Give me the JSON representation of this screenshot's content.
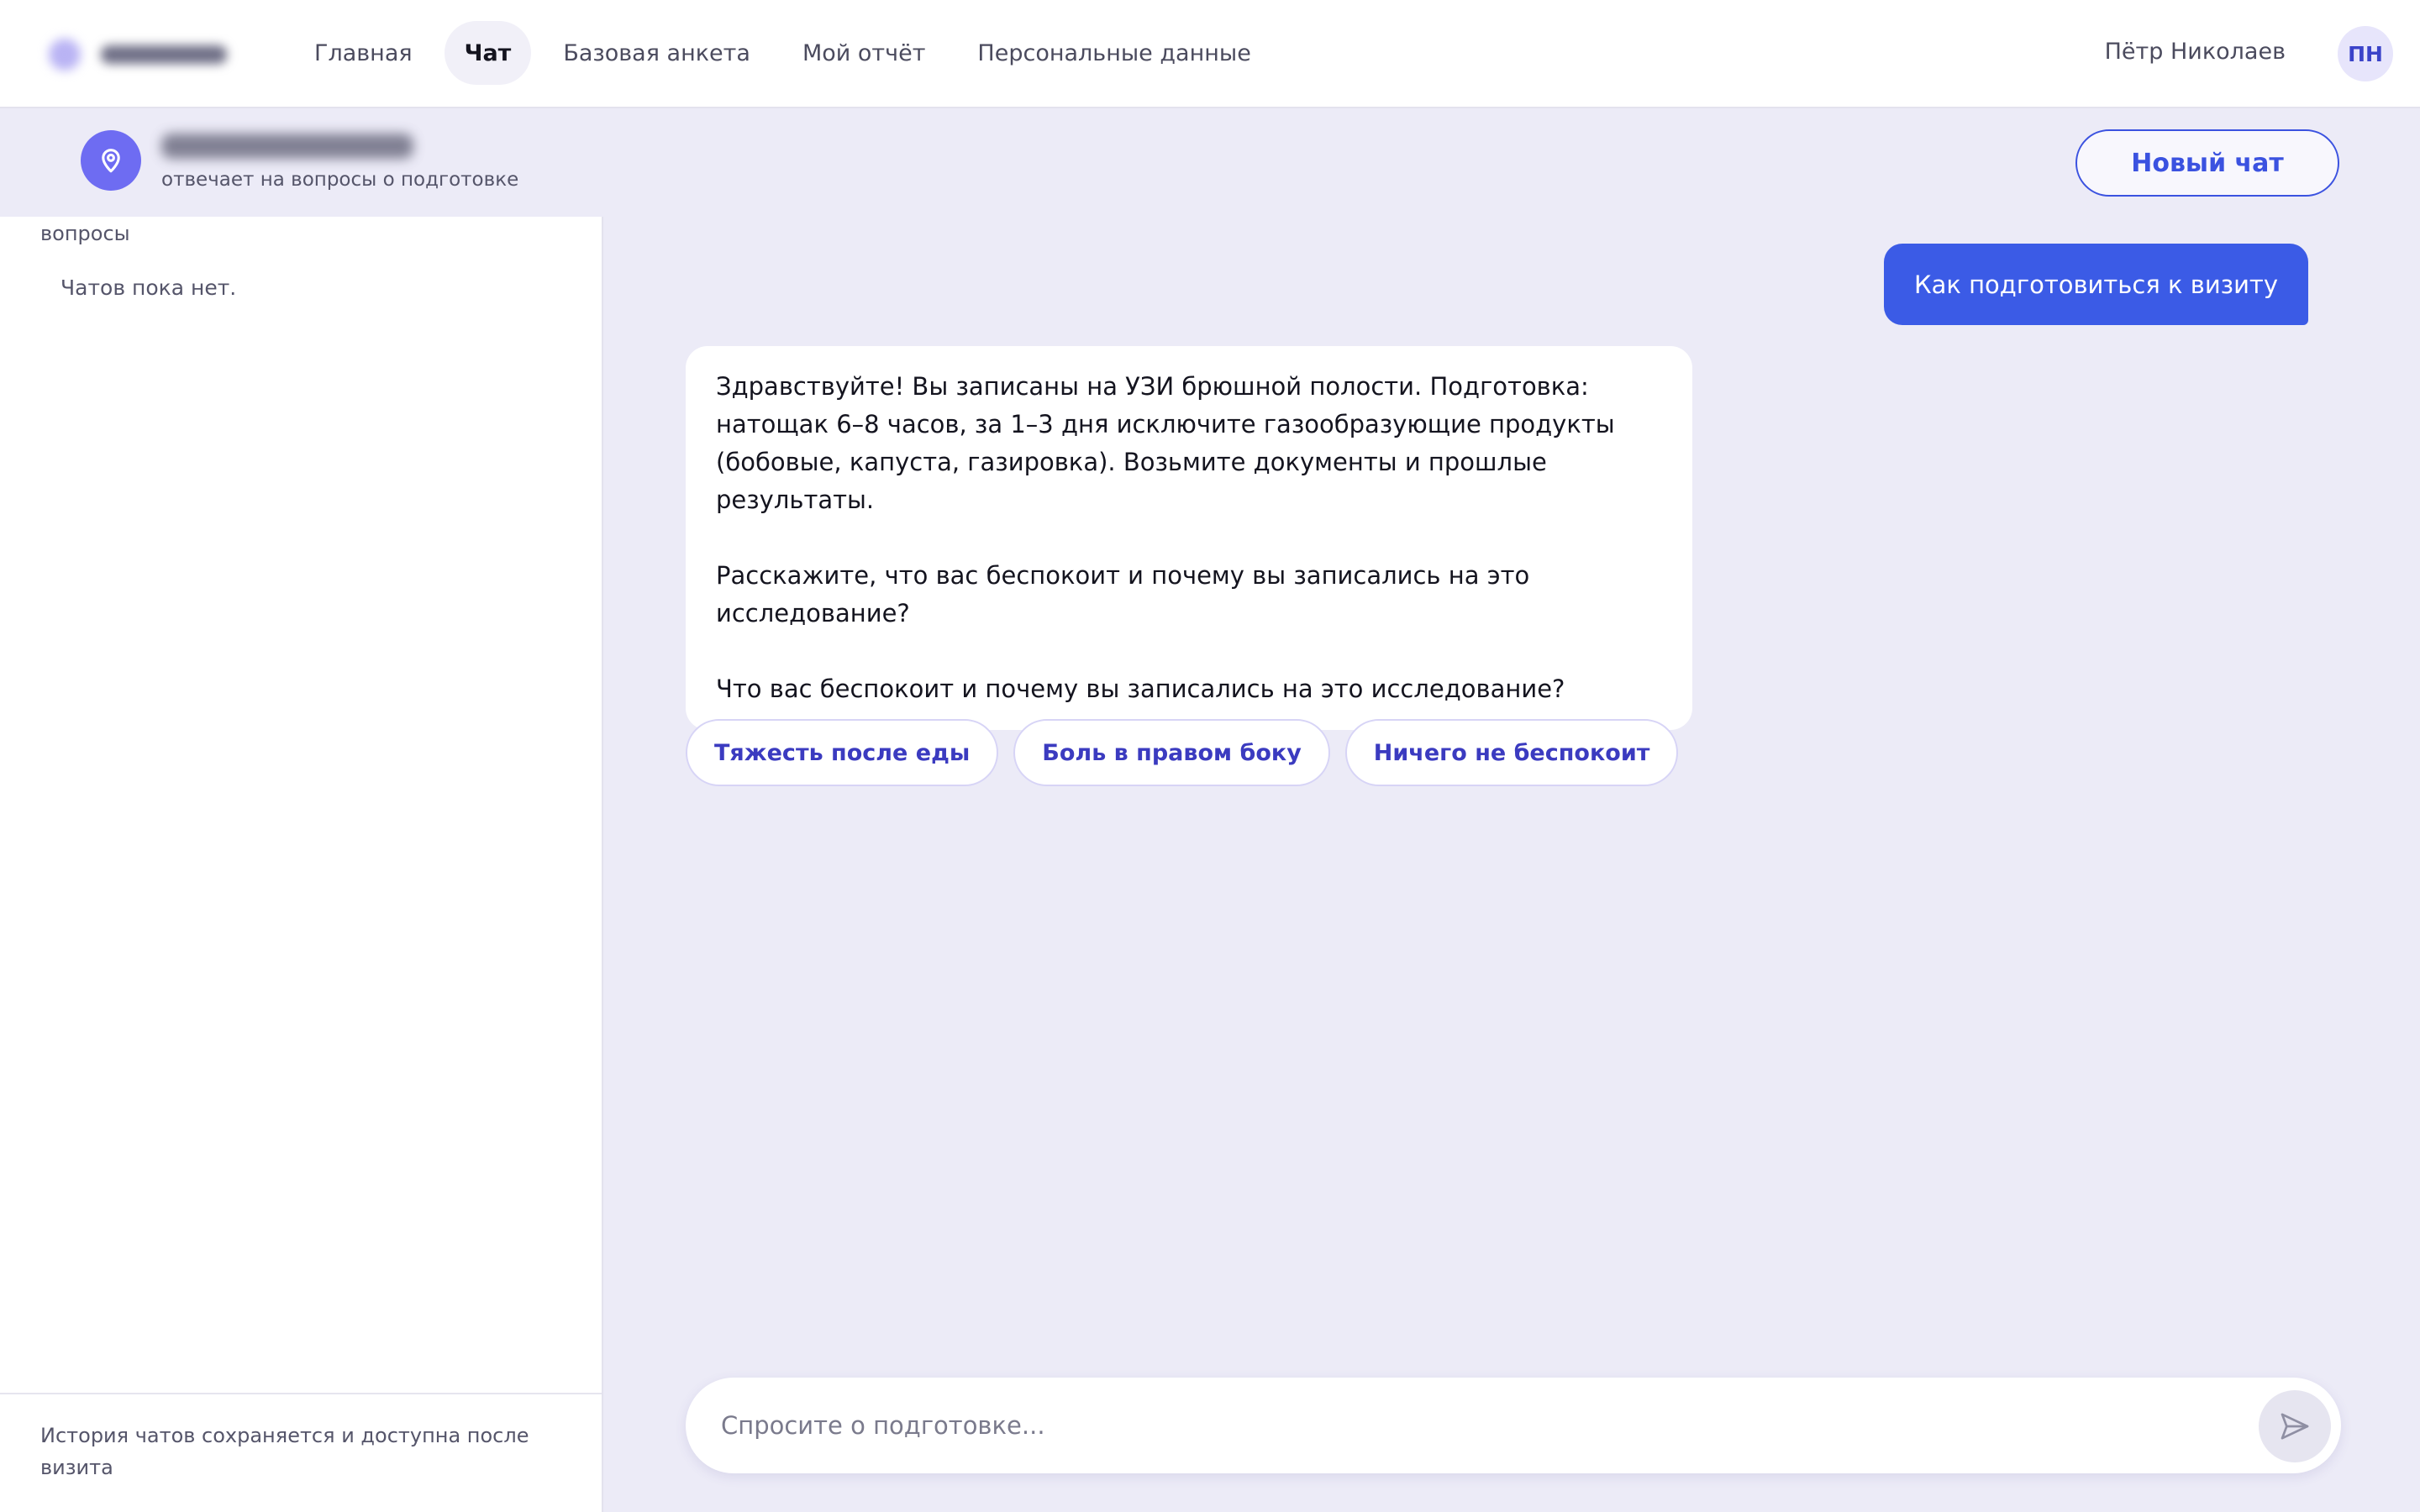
{
  "nav": {
    "items": [
      {
        "label": "Главная",
        "active": false
      },
      {
        "label": "Чат",
        "active": true
      },
      {
        "label": "Базовая анкета",
        "active": false
      },
      {
        "label": "Мой отчёт",
        "active": false
      },
      {
        "label": "Персональные данные",
        "active": false
      }
    ]
  },
  "user": {
    "name": "Пётр Николаев",
    "initials": "ПН"
  },
  "assistant": {
    "subtitle": "отвечает на вопросы о подготовке",
    "icon": "location-pin-icon"
  },
  "header": {
    "new_chat_label": "Новый чат"
  },
  "sidebar": {
    "heading": "вопросы",
    "empty_text": "Чатов пока нет.",
    "footer_text": "История чатов сохраняется и доступна после визита"
  },
  "messages": {
    "user": "Как подготовиться к визиту",
    "bot": {
      "p1": "Здравствуйте! Вы записаны на УЗИ брюшной полости. Подготовка: натощак 6–8 часов, за 1–3 дня исключите газообразующие продукты (бобовые, капуста, газировка). Возьмите документы и прошлые результаты.",
      "p2": "Расскажите, что вас беспокоит и почему вы записались на это исследование?",
      "p3": "Что вас беспокоит и почему вы записались на это исследование?"
    }
  },
  "quick_replies": [
    "Тяжесть после еды",
    "Боль в правом боку",
    "Ничего не беспокоит"
  ],
  "composer": {
    "placeholder": "Спросите о подготовке...",
    "value": "",
    "send_icon": "send-icon"
  },
  "colors": {
    "accent": "#3b5be6",
    "assistant_icon_bg": "#6e6cf2",
    "page_bg": "#ecebf7"
  }
}
